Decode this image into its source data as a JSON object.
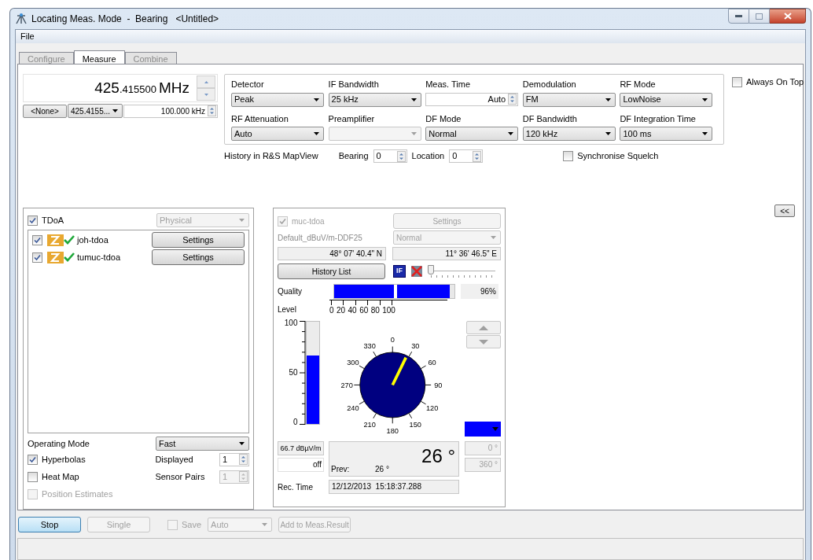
{
  "window": {
    "title": "Locating Meas. Mode  -  Bearing   <Untitled>"
  },
  "menu": [
    "File"
  ],
  "tabs": [
    {
      "label": "Configure",
      "selected": false
    },
    {
      "label": "Measure",
      "selected": true
    },
    {
      "label": "Combine",
      "selected": false
    }
  ],
  "frequency": {
    "integer": "425",
    "fraction": ".415500",
    "unit": "MHz",
    "preset": "<None>",
    "memory": "425.4155...",
    "step": "100.000 kHz"
  },
  "settings": [
    {
      "label": "Detector",
      "kind": "dropdown",
      "value": "Peak",
      "disabled": false
    },
    {
      "label": "IF Bandwidth",
      "kind": "dropdown",
      "value": "25 kHz",
      "disabled": false
    },
    {
      "label": "Meas. Time",
      "kind": "spin",
      "value": "Auto",
      "disabled": false
    },
    {
      "label": "Demodulation",
      "kind": "dropdown",
      "value": "FM",
      "disabled": false
    },
    {
      "label": "RF Mode",
      "kind": "dropdown",
      "value": "LowNoise",
      "disabled": false
    },
    {
      "label": "RF Attenuation",
      "kind": "dropdown",
      "value": "Auto",
      "disabled": false
    },
    {
      "label": "Preamplifier",
      "kind": "dropdown",
      "disabled": true
    },
    {
      "label": "DF Mode",
      "kind": "dropdown",
      "value": "Normal",
      "disabled": false
    },
    {
      "label": "DF Bandwidth",
      "kind": "dropdown",
      "value": "120 kHz",
      "disabled": false
    },
    {
      "label": "DF Integration Time",
      "kind": "dropdown",
      "value": "100 ms",
      "disabled": false
    }
  ],
  "always_on_top": {
    "label": "Always On Top",
    "checked": false
  },
  "history": {
    "label": "History in R&S MapView",
    "bearing_label": "Bearing",
    "bearing": "0",
    "location_label": "Location",
    "location": "0"
  },
  "sync_squelch": {
    "label": "Synchronise Squelch",
    "checked": false
  },
  "collapse_button": "<<",
  "tdoa": {
    "label": "TDoA",
    "checked": true,
    "mode": "Physical",
    "sensors": [
      {
        "name": "joh-tdoa",
        "checked": true,
        "settings": "Settings"
      },
      {
        "name": "tumuc-tdoa",
        "checked": true,
        "settings": "Settings"
      }
    ],
    "operating_mode_label": "Operating Mode",
    "operating_mode": "Fast",
    "options": [
      {
        "label": "Hyperbolas",
        "checked": true,
        "disabled": false,
        "count_label": "Displayed",
        "count": "1",
        "count_disabled": false
      },
      {
        "label": "Heat Map",
        "checked": false,
        "disabled": false,
        "count_label": "Sensor Pairs",
        "count": "1",
        "count_disabled": true
      },
      {
        "label": "Position Estimates",
        "checked": false,
        "disabled": true
      }
    ]
  },
  "station": {
    "name": "muc-tdoa",
    "checked": true,
    "disabled": true,
    "settings": "Settings",
    "profile": "Default_dBuV/m-DDF25",
    "mode": "Normal",
    "latitude": "48° 07' 40.4\" N",
    "longitude": "11° 36' 46.5\" E",
    "history_button": "History List",
    "if_badge": "IF",
    "slider": {
      "level": 0
    },
    "quality_label": "Quality",
    "quality": {
      "level": 0.96
    },
    "quality_reading": "96%",
    "level_label": "Level",
    "quality_scale": [
      "0",
      "20",
      "40",
      "60",
      "80",
      "100"
    ],
    "level_scale": [
      "100",
      "50",
      "0"
    ],
    "signal": {
      "level": 0.667
    },
    "level_reading": "66.7 dBµV/m",
    "squelch": "off",
    "dial_labels": [
      "0",
      "30",
      "60",
      "90",
      "120",
      "150",
      "180",
      "210",
      "240",
      "270",
      "300",
      "330"
    ],
    "bearing": "26 °",
    "prev_label": "Prev:",
    "prev": "26 °",
    "color": "#0000ff",
    "range_min": "0 °",
    "range_max": "360 °",
    "rec_time_label": "Rec. Time",
    "rec_time": "12/12/2013  15:18:37.288"
  },
  "toolbar": {
    "stop": "Stop",
    "single": "Single",
    "save_label": "Save",
    "save_checked": false,
    "save_mode": "Auto",
    "add": "Add to Meas.Result"
  }
}
